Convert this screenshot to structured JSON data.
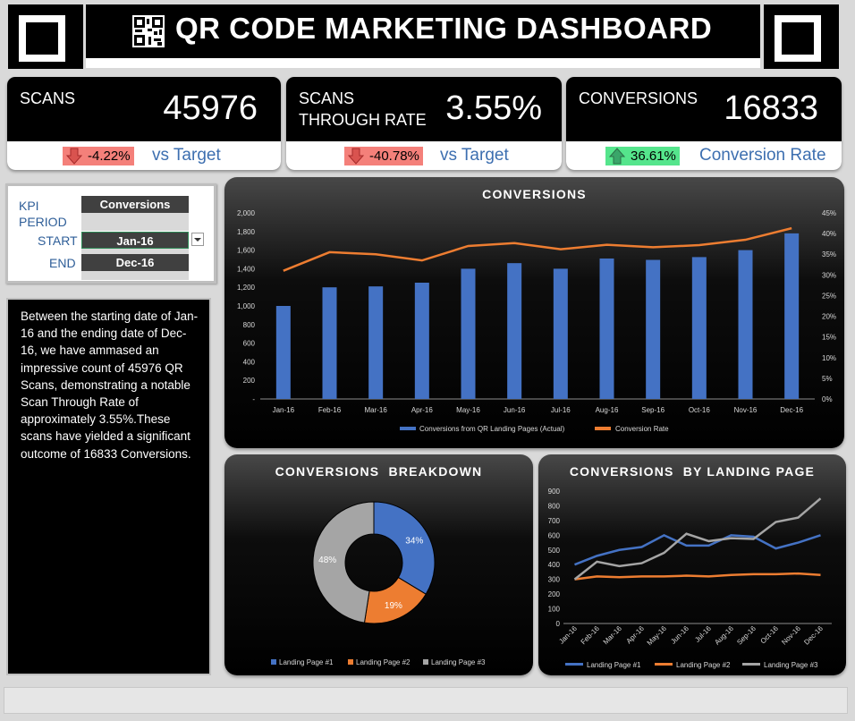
{
  "header": {
    "title": "QR CODE MARKETING DASHBOARD"
  },
  "kpis": {
    "scans": {
      "label": "SCANS",
      "value": "45976",
      "delta": "-4.22%",
      "compare": "vs Target",
      "trend": "down"
    },
    "str": {
      "label_line1": "SCANS",
      "label_line2": "THROUGH RATE",
      "value": "3.55%",
      "delta": "-40.78%",
      "compare": "vs Target",
      "trend": "down"
    },
    "conversions": {
      "label": "CONVERSIONS",
      "value": "16833",
      "delta": "36.61%",
      "compare": "Conversion Rate",
      "trend": "up"
    }
  },
  "period": {
    "kpi_label": "KPI",
    "kpi_value": "Conversions",
    "period_label": "PERIOD",
    "start_label": "START",
    "start_value": "Jan-16",
    "end_label": "END",
    "end_value": "Dec-16"
  },
  "description": "Between the starting date of Jan-16 and the ending date of Dec-16, we have ammased an impressive count of 45976 QR Scans, demonstrating a notable Scan Through Rate of approximately 3.55%.These scans have yielded a significant outcome of 16833 Conversions.",
  "colors": {
    "down": "#f4807a",
    "up": "#55e58c",
    "blue": "#4472c4",
    "orange": "#ed7d31",
    "grey": "#a5a5a5",
    "accent_text": "#3d6fb0"
  },
  "chart_data": [
    {
      "type": "bar",
      "title": "CONVERSIONS",
      "categories": [
        "Jan-16",
        "Feb-16",
        "Mar-16",
        "Apr-16",
        "May-16",
        "Jun-16",
        "Jul-16",
        "Aug-16",
        "Sep-16",
        "Oct-16",
        "Nov-16",
        "Dec-16"
      ],
      "series": [
        {
          "name": "Conversions from QR Landing Pages (Actual)",
          "kind": "bar",
          "axis": "left",
          "values": [
            1000,
            1200,
            1210,
            1250,
            1400,
            1460,
            1400,
            1510,
            1495,
            1525,
            1600,
            1780
          ]
        },
        {
          "name": "Conversion Rate",
          "kind": "line",
          "axis": "right",
          "values": [
            0.31,
            0.355,
            0.35,
            0.335,
            0.37,
            0.377,
            0.362,
            0.373,
            0.367,
            0.372,
            0.385,
            0.413
          ]
        }
      ],
      "ylim": [
        0,
        2000
      ],
      "y_ticks": [
        "-",
        "200",
        "400",
        "600",
        "800",
        "1,000",
        "1,200",
        "1,400",
        "1,600",
        "1,800",
        "2,000"
      ],
      "y2lim": [
        0,
        0.45
      ],
      "y2_ticks": [
        "0%",
        "5%",
        "10%",
        "15%",
        "20%",
        "25%",
        "30%",
        "35%",
        "40%",
        "45%"
      ],
      "legend_position": "bottom"
    },
    {
      "type": "pie",
      "title": "CONVERSIONS  BREAKDOWN",
      "donut": true,
      "slices": [
        {
          "name": "Landing Page #1",
          "value": 34,
          "label": "34%"
        },
        {
          "name": "Landing Page #2",
          "value": 19,
          "label": "19%"
        },
        {
          "name": "Landing Page #3",
          "value": 48,
          "label": "48%"
        }
      ],
      "legend_position": "bottom"
    },
    {
      "type": "line",
      "title": "CONVERSIONS  BY LANDING PAGE",
      "categories": [
        "Jan-16",
        "Feb-16",
        "Mar-16",
        "Apr-16",
        "May-16",
        "Jun-16",
        "Jul-16",
        "Aug-16",
        "Sep-16",
        "Oct-16",
        "Nov-16",
        "Dec-16"
      ],
      "series": [
        {
          "name": "Landing Page #1",
          "values": [
            400,
            460,
            500,
            520,
            600,
            530,
            530,
            600,
            590,
            510,
            550,
            600
          ]
        },
        {
          "name": "Landing Page #2",
          "values": [
            300,
            320,
            315,
            320,
            320,
            325,
            320,
            330,
            335,
            335,
            340,
            330
          ]
        },
        {
          "name": "Landing Page #3",
          "values": [
            300,
            420,
            390,
            410,
            480,
            610,
            560,
            580,
            575,
            690,
            720,
            850
          ]
        }
      ],
      "ylim": [
        0,
        900
      ],
      "y_ticks": [
        "0",
        "100",
        "200",
        "300",
        "400",
        "500",
        "600",
        "700",
        "800",
        "900"
      ],
      "legend_position": "bottom"
    }
  ]
}
